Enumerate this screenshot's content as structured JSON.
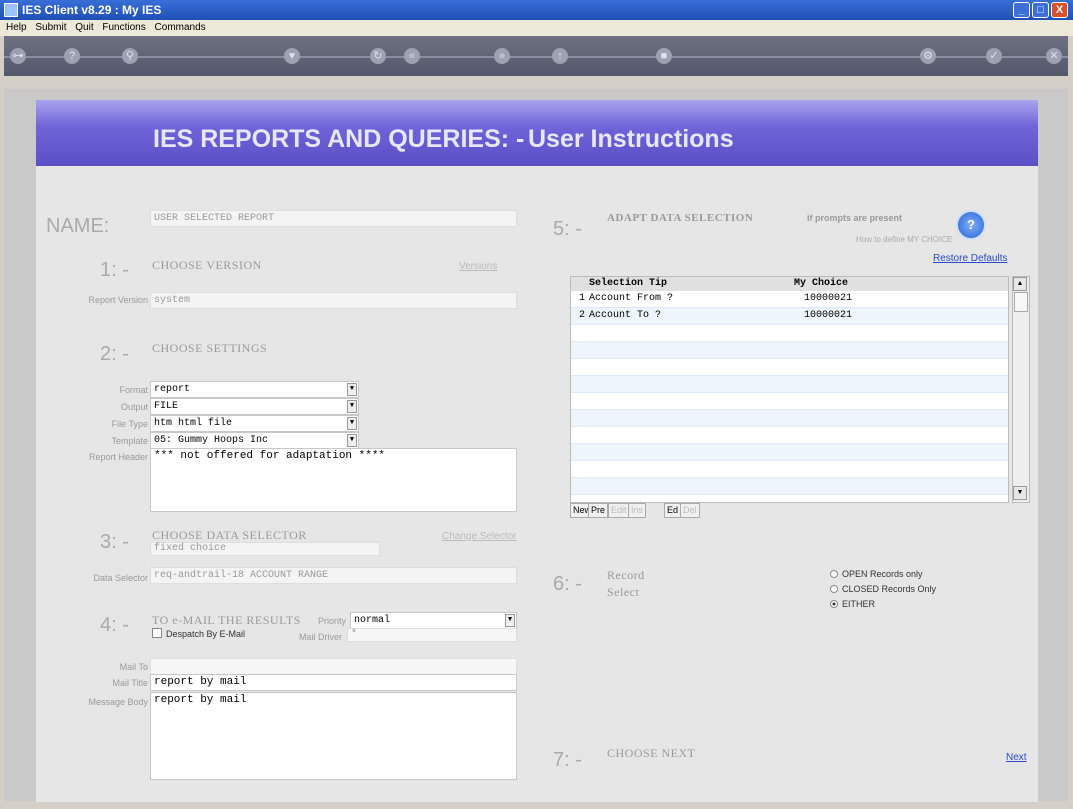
{
  "window": {
    "title": "IES Client v8.29 : My IES",
    "min": "_",
    "max": "□",
    "close": "X"
  },
  "menu": [
    "Help",
    "Submit",
    "Quit",
    "Functions",
    "Commands"
  ],
  "banner": {
    "left": "IES REPORTS AND QUERIES: -",
    "right": "User Instructions"
  },
  "name": {
    "label": "NAME:",
    "value": "USER SELECTED REPORT"
  },
  "section1": {
    "num": "1: -",
    "title": "CHOOSE VERSION",
    "link": "Versions",
    "report_version_label": "Report Version",
    "report_version": "system"
  },
  "section2": {
    "num": "2: -",
    "title": "CHOOSE SETTINGS",
    "format_label": "Format",
    "format": "report",
    "output_label": "Output",
    "output": "FILE",
    "filetype_label": "File Type",
    "filetype": "htm html file",
    "template_label": "Template",
    "template": "05: Gummy Hoops Inc",
    "header_label": "Report Header",
    "header": "*** not offered for adaptation ****"
  },
  "section3": {
    "num": "3: -",
    "title": "CHOOSE DATA SELECTOR",
    "link": "Change Selector",
    "fixed": "fixed choice",
    "selector_label": "Data Selector",
    "selector": "req-andtrail-18 ACCOUNT RANGE"
  },
  "section4": {
    "num": "4: -",
    "title": "TO e-MAIL THE RESULTS",
    "priority_label": "Priority",
    "priority": "normal",
    "despatch": "Despatch By E-Mail",
    "maildriver_label": "Mail Driver",
    "maildriver": "*",
    "mailto_label": "Mail To",
    "mailtitle_label": "Mail Title",
    "mailtitle": "report by mail",
    "body_label": "Message Body",
    "body": "report by mail"
  },
  "section5": {
    "num": "5: -",
    "title": "ADAPT DATA SELECTION",
    "subtitle": "if prompts are present",
    "howto": "How to define MY CHOICE",
    "restore": "Restore Defaults",
    "help": "?",
    "col1": "Selection Tip",
    "col2": "My Choice",
    "rows": [
      {
        "n": "1",
        "tip": "Account From ?",
        "choice": "10000021"
      },
      {
        "n": "2",
        "tip": "Account To ?",
        "choice": "10000021"
      }
    ],
    "buttons": [
      "New",
      "Pre",
      "Edit",
      "Ins",
      "Ed",
      "Del"
    ]
  },
  "section6": {
    "num": "6: -",
    "title1": "Record",
    "title2": "Select",
    "opt1": "OPEN Records only",
    "opt2": "CLOSED Records Only",
    "opt3": "EITHER"
  },
  "section7": {
    "num": "7: -",
    "title": "CHOOSE NEXT",
    "next": "Next"
  }
}
